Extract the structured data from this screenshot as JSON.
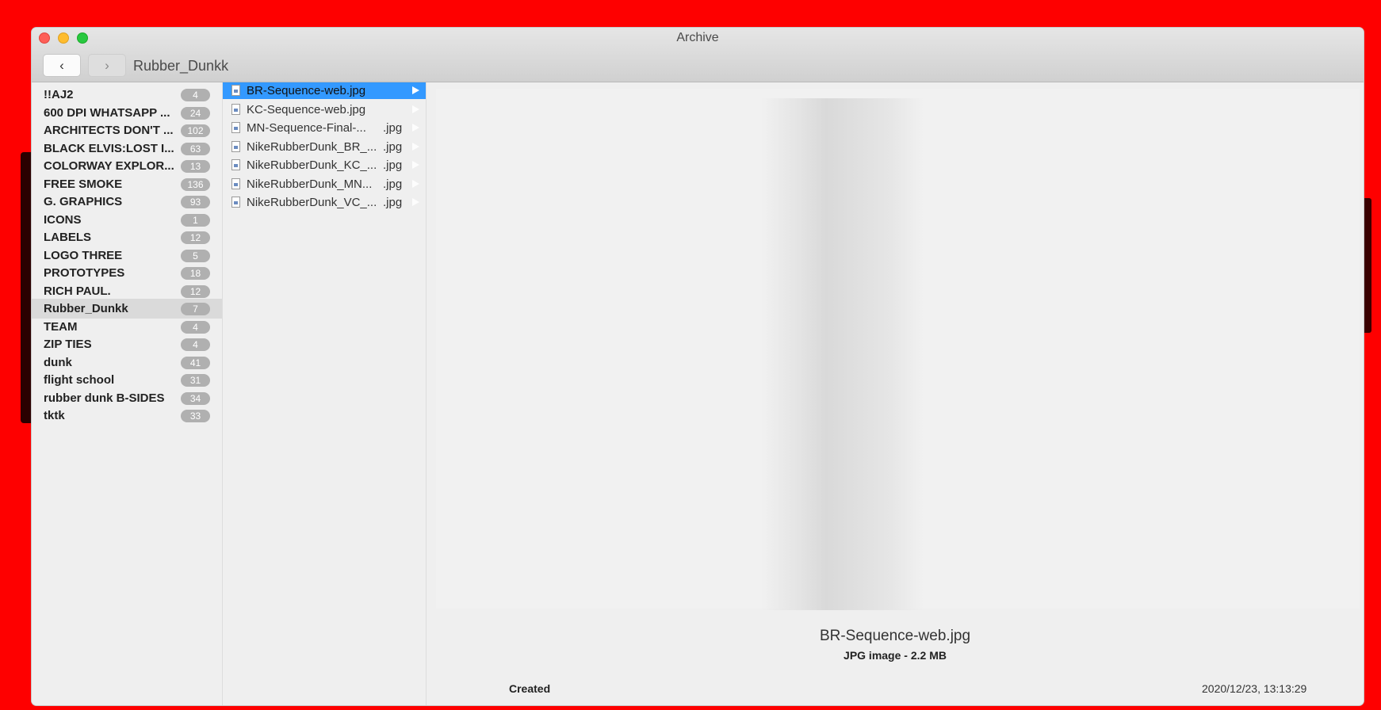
{
  "window": {
    "title": "Archive",
    "path": "Rubber_Dunkk",
    "back_label": "‹",
    "forward_label": "›"
  },
  "sidebar": {
    "items": [
      {
        "label": "!!AJ2",
        "count": "4"
      },
      {
        "label": "600 DPI WHATSAPP ...",
        "count": "24"
      },
      {
        "label": "ARCHITECTS DON'T ...",
        "count": "102"
      },
      {
        "label": "BLACK ELVIS:LOST I...",
        "count": "63"
      },
      {
        "label": "COLORWAY EXPLOR...",
        "count": "13"
      },
      {
        "label": "FREE SMOKE",
        "count": "136"
      },
      {
        "label": "G. GRAPHICS",
        "count": "93"
      },
      {
        "label": "ICONS",
        "count": "1"
      },
      {
        "label": "LABELS",
        "count": "12"
      },
      {
        "label": "LOGO THREE",
        "count": "5"
      },
      {
        "label": "PROTOTYPES",
        "count": "18"
      },
      {
        "label": "RICH PAUL.",
        "count": "12"
      },
      {
        "label": "Rubber_Dunkk",
        "count": "7",
        "selected": true
      },
      {
        "label": "TEAM",
        "count": "4"
      },
      {
        "label": "ZIP TIES",
        "count": "4"
      },
      {
        "label": "dunk",
        "count": "41"
      },
      {
        "label": "flight school",
        "count": "31"
      },
      {
        "label": "rubber dunk B-SIDES",
        "count": "34"
      },
      {
        "label": "tktk",
        "count": "33"
      }
    ]
  },
  "files": [
    {
      "name": "BR-Sequence-web.jpg",
      "ext": "",
      "selected": true
    },
    {
      "name": "KC-Sequence-web.jpg",
      "ext": ""
    },
    {
      "name": "MN-Sequence-Final-...",
      "ext": ".jpg"
    },
    {
      "name": "NikeRubberDunk_BR_...",
      "ext": ".jpg"
    },
    {
      "name": "NikeRubberDunk_KC_...",
      "ext": ".jpg"
    },
    {
      "name": "NikeRubberDunk_MN...",
      "ext": ".jpg"
    },
    {
      "name": "NikeRubberDunk_VC_...",
      "ext": ".jpg"
    }
  ],
  "preview": {
    "file_name": "BR-Sequence-web.jpg",
    "file_info": "JPG image - 2.2 MB",
    "created_label": "Created",
    "created_value": "2020/12/23, 13:13:29"
  },
  "icons": {
    "file": "image-file-icon",
    "expand": "disclosure-arrow-icon"
  },
  "colors": {
    "desktop": "#fe0000",
    "selection": "#3399ff",
    "badge": "#b0b0b0"
  }
}
